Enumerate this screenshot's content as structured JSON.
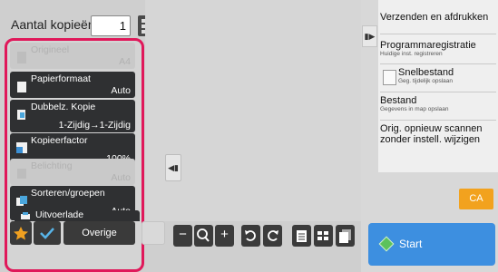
{
  "copies": {
    "label": "Aantal kopieën",
    "value": "1"
  },
  "functions": [
    {
      "name": "Origineel",
      "value": "A4",
      "enabled": false,
      "icon": "original-icon"
    },
    {
      "name": "Papierformaat",
      "value": "Auto",
      "enabled": true,
      "icon": "paper-size-icon"
    },
    {
      "name": "Dubbelz. Kopie",
      "value": "1-Zijdig→1-Zijdig",
      "enabled": true,
      "icon": "duplex-copy-icon"
    },
    {
      "name": "Kopieerfactor",
      "value": "100%",
      "enabled": true,
      "icon": "copy-ratio-icon"
    },
    {
      "name": "Belichting",
      "value": "Auto",
      "enabled": false,
      "icon": "exposure-icon"
    },
    {
      "name": "Sorteren/groepen",
      "value": "Auto",
      "enabled": true,
      "icon": "sort-group-icon"
    },
    {
      "name": "Uitvoerlade",
      "value": "",
      "enabled": true,
      "icon": "output-tray-icon"
    }
  ],
  "bottom_left": {
    "favorite_icon": "star-icon",
    "check_icon": "check-icon",
    "other_label": "Overige"
  },
  "toolbar": {
    "zoom_out": "−",
    "zoom_icon": "magnifier-icon",
    "zoom_in": "+",
    "rotate_left_icon": "rotate-left-icon",
    "rotate_right_icon": "rotate-right-icon",
    "page_view_icon": "single-page-icon",
    "grid_view_icon": "grid-view-icon",
    "multi_view_icon": "multi-page-icon"
  },
  "actions": [
    {
      "title": "Verzenden en afdrukken",
      "sub": ""
    },
    {
      "title": "Programmaregistratie",
      "sub": "Huidige inst. registreren"
    },
    {
      "title": "Snelbestand",
      "sub": "Geg. tijdelijk opslaan"
    },
    {
      "title": "Bestand",
      "sub": "Gegevens in map opslaan"
    },
    {
      "title": "Orig. opnieuw scannen zonder instell. wijzigen",
      "sub": ""
    }
  ],
  "ca_label": "CA",
  "start_label": "Start",
  "colors": {
    "highlight_border": "#e0185a",
    "ca": "#f2a21e",
    "start": "#3d8fe0",
    "check": "#58b4e8",
    "star": "#f0a020"
  }
}
